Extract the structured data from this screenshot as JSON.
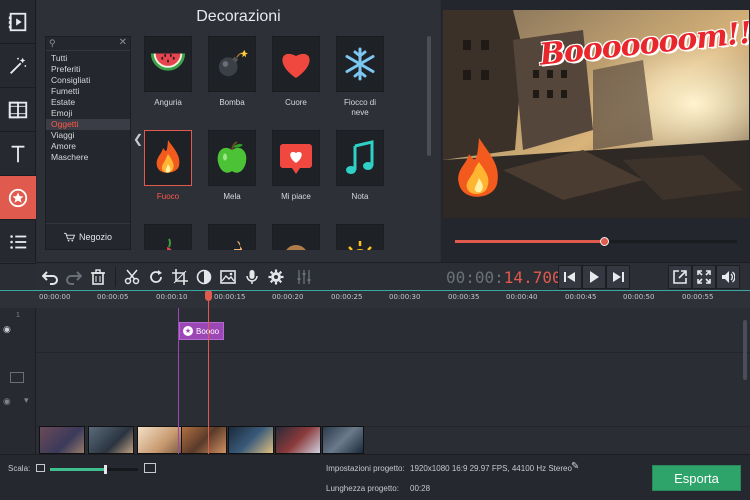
{
  "panel": {
    "title": "Decorazioni",
    "categories": [
      "Tutti",
      "Preferiti",
      "Consigliati",
      "Fumetti",
      "Estate",
      "Emoji",
      "Oggetti",
      "Viaggi",
      "Amore",
      "Maschere"
    ],
    "active_category": "Oggetti",
    "shop_label": "Negozio",
    "stickers": [
      {
        "label": "Anguria",
        "icon": "watermelon-icon"
      },
      {
        "label": "Bomba",
        "icon": "bomb-icon"
      },
      {
        "label": "Cuore",
        "icon": "heart-icon"
      },
      {
        "label": "Fiocco di neve",
        "icon": "snowflake-icon"
      },
      {
        "label": "Fuoco",
        "icon": "fire-icon",
        "selected": true
      },
      {
        "label": "Mela",
        "icon": "apple-icon"
      },
      {
        "label": "Mi piace",
        "icon": "like-heart-icon"
      },
      {
        "label": "Nota",
        "icon": "music-note-icon"
      }
    ]
  },
  "preview": {
    "overlay_text": "Booooooom!!!",
    "progress": 0.53
  },
  "toolbar": {
    "timecode_dim": "00:00:",
    "timecode_red": "14.700"
  },
  "timeline": {
    "ticks": [
      "00:00:00",
      "00:00:05",
      "00:00:10",
      "00:00:15",
      "00:00:20",
      "00:00:25",
      "00:00:30",
      "00:00:35",
      "00:00:40",
      "00:00:45",
      "00:00:50",
      "00:00:55"
    ],
    "title_clip": "Boooo",
    "track_number": "1"
  },
  "bottom": {
    "scale_label": "Scala:",
    "scale_value": 0.62,
    "settings_label": "Impostazioni progetto:",
    "settings_value": "1920x1080 16:9 29.97 FPS, 44100 Hz Stereo",
    "length_label": "Lunghezza progetto:",
    "length_value": "00:28",
    "export_label": "Esporta"
  },
  "colors": {
    "accent": "#e05a4d",
    "export": "#2ea36a",
    "title_clip": "#9b47b5"
  }
}
